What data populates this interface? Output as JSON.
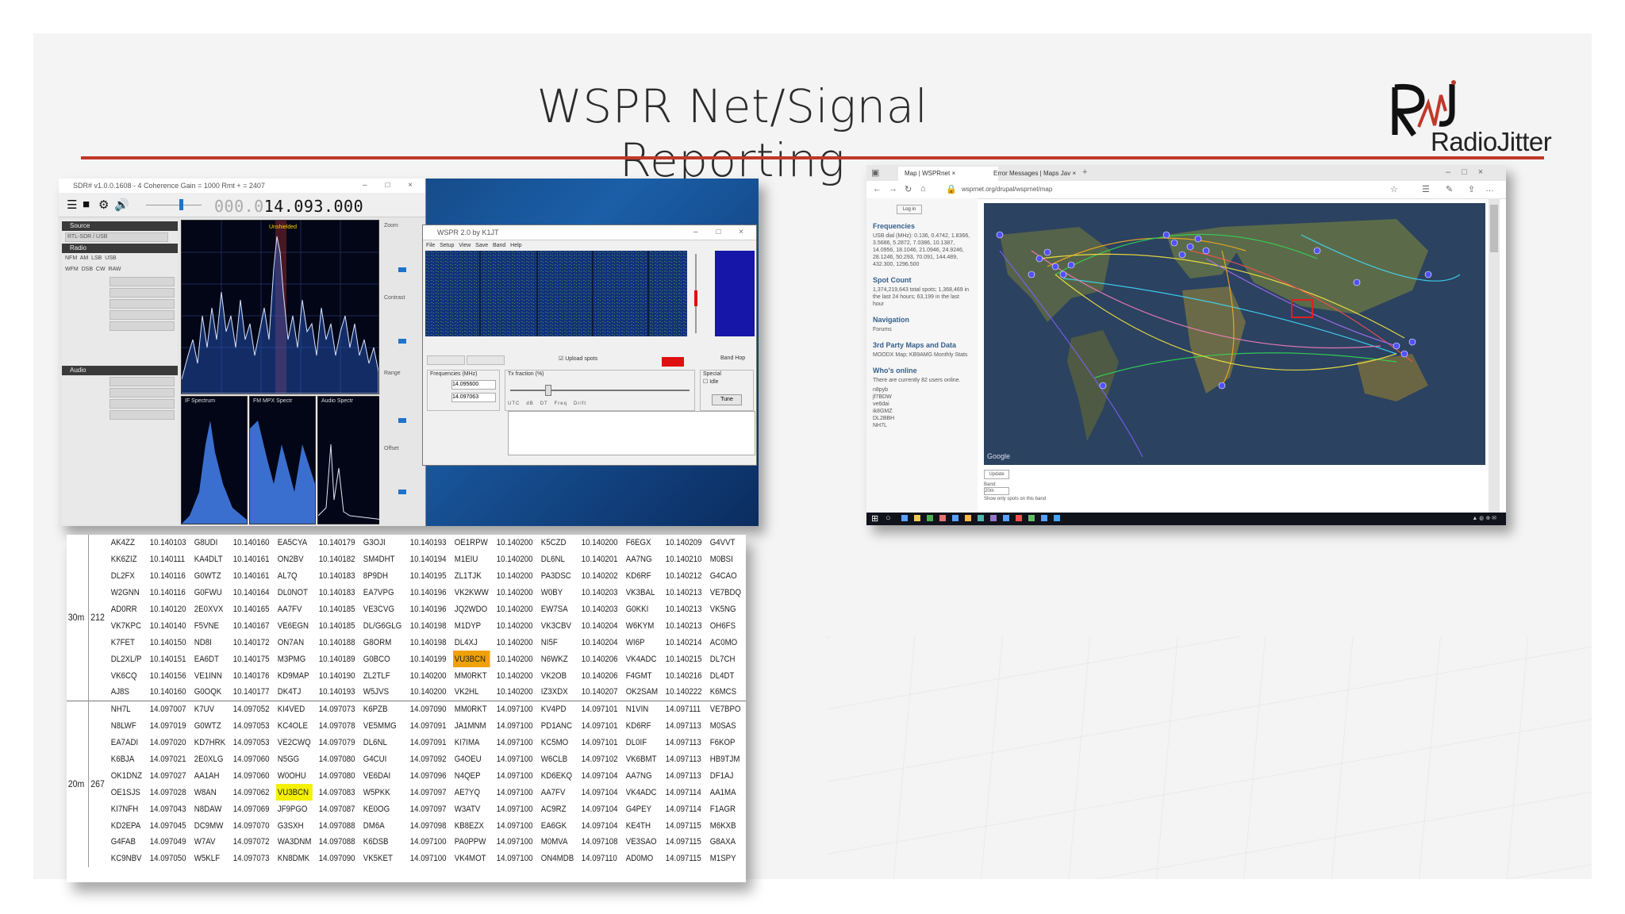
{
  "slide": {
    "title": "WSPR Net/Signal Reporting",
    "logo_text": "RadioJitter",
    "accent_color": "#c0392b"
  },
  "sdr_window": {
    "title": "SDR# v1.0.0.1608 - 4 Coherence Gain = 1000 Rmt + = 2407",
    "frequency_dim": "000.0",
    "frequency": "14.093.000",
    "spectrum_label": "Unshielded",
    "panel_labels": [
      "IF Spectrum",
      "FM MPX Spectr",
      "Audio Spectr"
    ],
    "slider_labels": [
      "Zoom",
      "Contrast",
      "Range",
      "Offset"
    ],
    "sections": [
      "Source",
      "Radio",
      "Audio"
    ],
    "source_value": "RTL-SDR / USB",
    "modes": [
      "NFM",
      "AM",
      "LSB",
      "USB",
      "WFM",
      "DSB",
      "CW",
      "RAW"
    ]
  },
  "wspr_window": {
    "title": "WSPR 2.0   by K1JT",
    "menu": [
      "File",
      "Setup",
      "View",
      "Save",
      "Band",
      "Help"
    ],
    "upload_label": "Upload spots",
    "dial_value": "14.095600",
    "tx_value": "14.097063",
    "labels": [
      "Frequencies (MHz)",
      "Tx fraction (%)",
      "Special",
      "Idle",
      "Tune",
      "Band Hop"
    ],
    "table_header": [
      "UTC",
      "dB",
      "DT",
      "Freq",
      "Drift"
    ]
  },
  "spot_table": {
    "bands": [
      {
        "band": "30m",
        "count": "212",
        "rows": [
          [
            "AK4ZZ",
            "10.140103",
            "G8UDI",
            "10.140160",
            "EA5CYA",
            "10.140179",
            "G3OJI",
            "10.140193",
            "OE1RPW",
            "10.140200",
            "K5CZD",
            "10.140200",
            "F6EGX",
            "10.140209",
            "G4VVT"
          ],
          [
            "KK6ZIZ",
            "10.140111",
            "KA4DLT",
            "10.140161",
            "ON2BV",
            "10.140182",
            "SM4DHT",
            "10.140194",
            "M1EIU",
            "10.140200",
            "DL6NL",
            "10.140201",
            "AA7NG",
            "10.140210",
            "M0BSI"
          ],
          [
            "DL2FX",
            "10.140116",
            "G0WTZ",
            "10.140161",
            "AL7Q",
            "10.140183",
            "8P9DH",
            "10.140195",
            "ZL1TJK",
            "10.140200",
            "PA3DSC",
            "10.140202",
            "KD6RF",
            "10.140212",
            "G4CAO"
          ],
          [
            "W2GNN",
            "10.140116",
            "G0FWU",
            "10.140164",
            "DL0NOT",
            "10.140183",
            "EA7VPG",
            "10.140196",
            "VK2KWW",
            "10.140200",
            "W0BY",
            "10.140203",
            "VK3BAL",
            "10.140213",
            "VE7BDQ"
          ],
          [
            "AD0RR",
            "10.140120",
            "2E0XVX",
            "10.140165",
            "AA7FV",
            "10.140185",
            "VE3CVG",
            "10.140196",
            "JQ2WDO",
            "10.140200",
            "EW7SA",
            "10.140203",
            "G0KKI",
            "10.140213",
            "VK5NG"
          ],
          [
            "VK7KPC",
            "10.140140",
            "F5VNE",
            "10.140167",
            "VE6EGN",
            "10.140185",
            "DL/G6GLG",
            "10.140198",
            "M1DYP",
            "10.140200",
            "VK3CBV",
            "10.140204",
            "W6KYM",
            "10.140213",
            "OH6FS"
          ],
          [
            "K7FET",
            "10.140150",
            "ND8I",
            "10.140172",
            "ON7AN",
            "10.140188",
            "G8ORM",
            "10.140198",
            "DL4XJ",
            "10.140200",
            "NI5F",
            "10.140204",
            "WI6P",
            "10.140214",
            "AC0MO"
          ],
          [
            "DL2XL/P",
            "10.140151",
            "EA6DT",
            "10.140175",
            "M3PMG",
            "10.140189",
            "G0BCO",
            "10.140199",
            "VU3BCN",
            "10.140200",
            "N6WKZ",
            "10.140206",
            "VK4ADC",
            "10.140215",
            "DL7CH"
          ],
          [
            "VK6CQ",
            "10.140156",
            "VE1INN",
            "10.140176",
            "KD9MAP",
            "10.140190",
            "ZL2TLF",
            "10.140200",
            "MM0RKT",
            "10.140200",
            "VK2OB",
            "10.140206",
            "F4GMT",
            "10.140216",
            "DL4DT"
          ],
          [
            "AJ8S",
            "10.140160",
            "G0OQK",
            "10.140177",
            "DK4TJ",
            "10.140193",
            "W5JVS",
            "10.140200",
            "VK2HL",
            "10.140200",
            "IZ3XDX",
            "10.140207",
            "OK2SAM",
            "10.140222",
            "K6MCS"
          ]
        ]
      },
      {
        "band": "20m",
        "count": "267",
        "rows": [
          [
            "NH7L",
            "14.097007",
            "K7UV",
            "14.097052",
            "KI4VED",
            "14.097073",
            "K6PZB",
            "14.097090",
            "MM0RKT",
            "14.097100",
            "KV4PD",
            "14.097101",
            "N1VIN",
            "14.097111",
            "VE7BPO"
          ],
          [
            "N8LWF",
            "14.097019",
            "G0WTZ",
            "14.097053",
            "KC4OLE",
            "14.097078",
            "VE5MMG",
            "14.097091",
            "JA1MNM",
            "14.097100",
            "PD1ANC",
            "14.097101",
            "KD6RF",
            "14.097113",
            "M0SAS"
          ],
          [
            "EA7ADI",
            "14.097020",
            "KD7HRK",
            "14.097053",
            "VE2CWQ",
            "14.097079",
            "DL6NL",
            "14.097091",
            "KI7IMA",
            "14.097100",
            "KC5MO",
            "14.097101",
            "DL0IF",
            "14.097113",
            "F6KOP"
          ],
          [
            "K6BJA",
            "14.097021",
            "2E0XLG",
            "14.097060",
            "N5GG",
            "14.097080",
            "G4CUI",
            "14.097092",
            "G4OEU",
            "14.097100",
            "W6CLB",
            "14.097102",
            "VK6BMT",
            "14.097113",
            "HB9TJM"
          ],
          [
            "OK1DNZ",
            "14.097027",
            "AA1AH",
            "14.097060",
            "W0OHU",
            "14.097080",
            "VE6DAI",
            "14.097096",
            "N4QEP",
            "14.097100",
            "KD6EKQ",
            "14.097104",
            "AA7NG",
            "14.097113",
            "DF1AJ"
          ],
          [
            "OE1SJS",
            "14.097028",
            "W8AN",
            "14.097062",
            "VU3BCN",
            "14.097083",
            "W5PKK",
            "14.097097",
            "AE7YQ",
            "14.097100",
            "AA7FV",
            "14.097104",
            "VK4ADC",
            "14.097114",
            "AA1MA"
          ],
          [
            "KI7NFH",
            "14.097043",
            "N8DAW",
            "14.097069",
            "JF9PGO",
            "14.097087",
            "KE0OG",
            "14.097097",
            "W3ATV",
            "14.097100",
            "AC9RZ",
            "14.097104",
            "G4PEY",
            "14.097114",
            "F1AGR"
          ],
          [
            "KD2EPA",
            "14.097045",
            "DC9MW",
            "14.097070",
            "G3SXH",
            "14.097088",
            "DM6A",
            "14.097098",
            "KB8EZX",
            "14.097100",
            "EA6GK",
            "14.097104",
            "KE4TH",
            "14.097115",
            "M6KXB"
          ],
          [
            "G4FAB",
            "14.097049",
            "W7AV",
            "14.097072",
            "WA3DNM",
            "14.097088",
            "K6DSB",
            "14.097100",
            "PA0PPW",
            "14.097100",
            "M0MVA",
            "14.097108",
            "VE3SAO",
            "14.097115",
            "G8AXA"
          ],
          [
            "KC9NBV",
            "14.097050",
            "W5KLF",
            "14.097073",
            "KN8DMK",
            "14.097090",
            "VK5KET",
            "14.097100",
            "VK4MOT",
            "14.097100",
            "ON4MDB",
            "14.097110",
            "AD0MO",
            "14.097115",
            "M1SPY"
          ]
        ]
      }
    ],
    "highlights": {
      "30m": {
        "row": 7,
        "col": 8,
        "color": "#f0a10a"
      },
      "20m": {
        "row": 5,
        "col": 4,
        "color": "#f4f000"
      }
    }
  },
  "browser": {
    "tab_active": "Map | WSPRnet",
    "tab_2": "Error Messages | Maps Jav",
    "url": "wsprnet.org/drupal/wsprnet/map",
    "login_button": "Log in",
    "sidebar": [
      {
        "heading": "Frequencies",
        "text": "USB dial (MHz): 0.136, 0.4742, 1.8366, 3.5686, 5.2872, 7.0386, 10.1387, 14.0956, 18.1046, 21.0946, 24.9246, 28.1246, 50.293, 70.091, 144.489, 432.300, 1296.500"
      },
      {
        "heading": "Spot Count",
        "text": "1,374,219,643 total spots; 1,368,469 in the last 24 hours; 63,199 in the last hour"
      },
      {
        "heading": "Navigation",
        "text": "Forums"
      },
      {
        "heading": "3rd Party Maps and Data",
        "text": "MOODX Map; KB9AMG Monthly Stats"
      },
      {
        "heading": "Who's online",
        "text": "There are currently 82 users online."
      }
    ],
    "online_users": [
      "n8pyb",
      "jf7BDW",
      "ve6dai",
      "ik8GMZ",
      "DL2BBH",
      "NH7L"
    ],
    "map_footer": "Google",
    "update_button": "Update",
    "band_label": "Band:",
    "band_value": "20m",
    "band_note": "Show only spots on this band",
    "zoom_in": "+",
    "zoom_out": "−"
  }
}
